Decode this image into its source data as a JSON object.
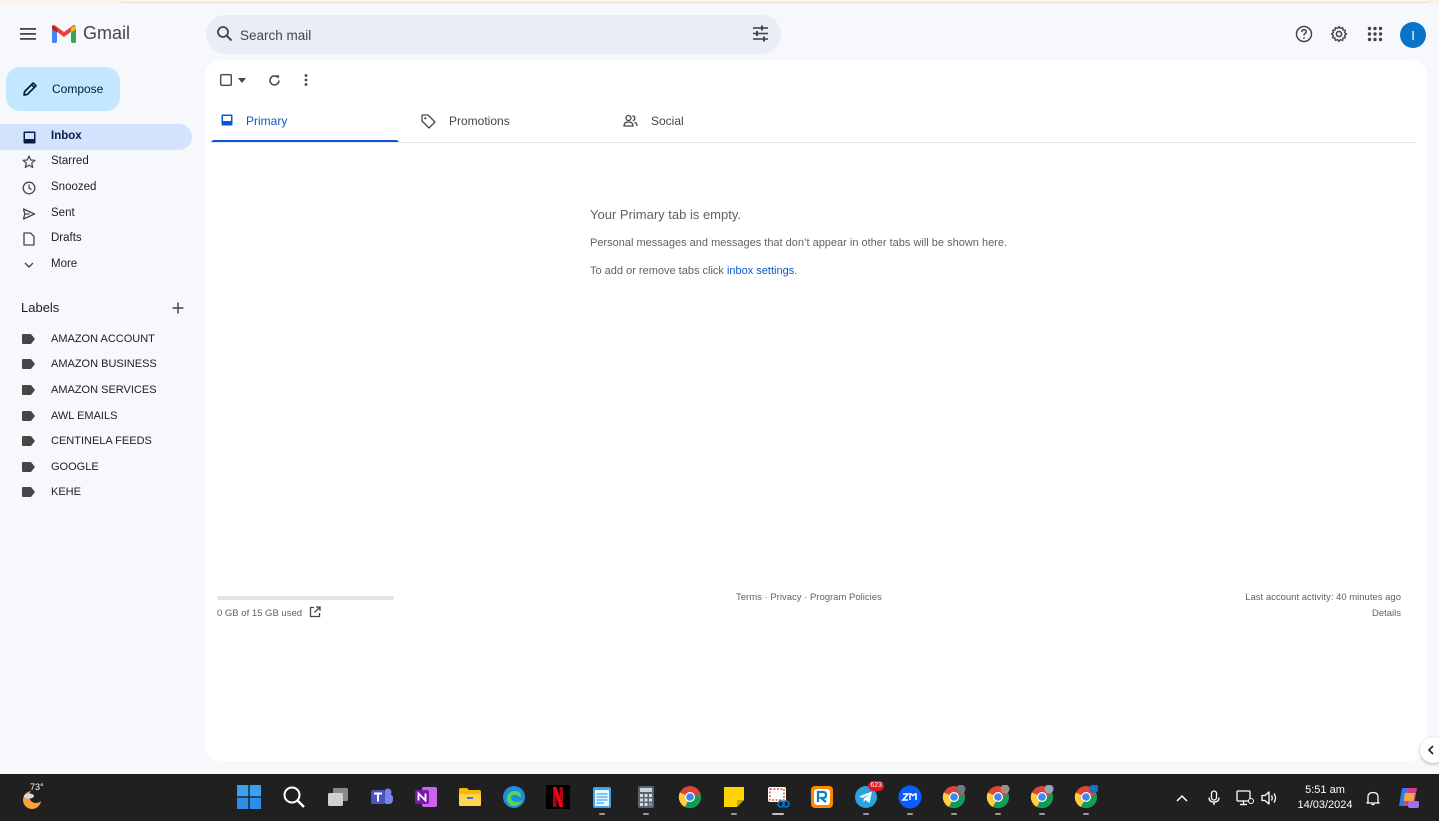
{
  "header": {
    "app_name": "Gmail",
    "search_placeholder": "Search mail",
    "avatar_initial": "I"
  },
  "sidebar": {
    "compose_label": "Compose",
    "items": [
      {
        "label": "Inbox",
        "icon": "inbox-icon",
        "active": true
      },
      {
        "label": "Starred",
        "icon": "star-icon"
      },
      {
        "label": "Snoozed",
        "icon": "clock-icon"
      },
      {
        "label": "Sent",
        "icon": "send-icon"
      },
      {
        "label": "Drafts",
        "icon": "draft-icon"
      },
      {
        "label": "More",
        "icon": "chevron-down-icon"
      }
    ],
    "labels_title": "Labels",
    "labels": [
      "AMAZON ACCOUNT",
      "AMAZON BUSINESS",
      "AMAZON SERVICES",
      "AWL EMAILS",
      "CENTINELA FEEDS",
      "GOOGLE",
      "KEHE"
    ]
  },
  "tabs": [
    {
      "label": "Primary",
      "active": true
    },
    {
      "label": "Promotions"
    },
    {
      "label": "Social"
    }
  ],
  "empty_state": {
    "title": "Your Primary tab is empty.",
    "description": "Personal messages and messages that don’t appear in other tabs will be shown here.",
    "settings_prefix": "To add or remove tabs click ",
    "settings_link": "inbox settings",
    "settings_suffix": "."
  },
  "footer": {
    "storage": "0 GB of 15 GB used",
    "storage_fraction": 0,
    "terms": "Terms",
    "privacy": "Privacy",
    "program_policies": "Program Policies",
    "separator": " · ",
    "last_activity": "Last account activity: 40 minutes ago",
    "details": "Details"
  },
  "taskbar": {
    "weather_temp": "73°",
    "telegram_badge": "623",
    "clock_time": "5:51 am",
    "clock_date": "14/03/2024"
  },
  "colors": {
    "accent": "#0b57d0",
    "compose_bg": "#c2e7ff",
    "active_nav_bg": "#d3e3fd",
    "avatar_bg": "#0b72c9"
  }
}
